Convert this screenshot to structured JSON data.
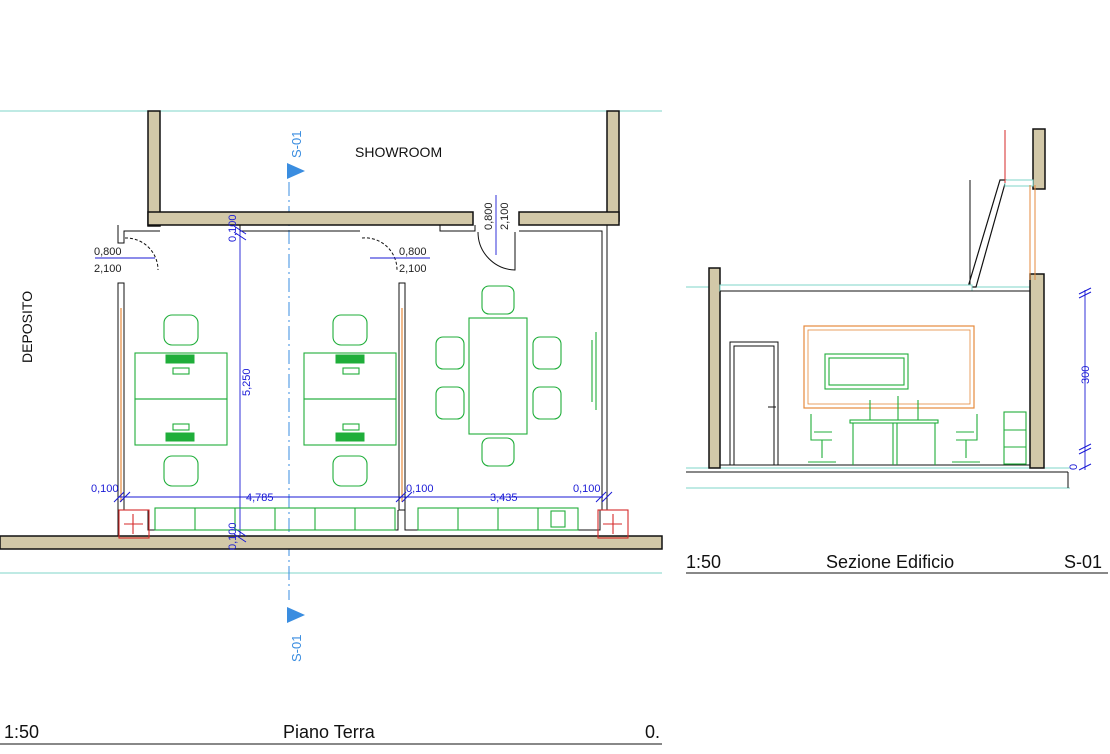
{
  "plan": {
    "showroom_label": "SHOWROOM",
    "deposito_label": "DEPOSITO",
    "section_tag_top": "S-01",
    "section_tag_bottom": "S-01",
    "door_left": {
      "width": "0,800",
      "height": "2,100"
    },
    "door_middle": {
      "width": "0,800",
      "height": "2,100"
    },
    "door_top": {
      "width": "0,800",
      "height": "2,100"
    },
    "dim_top_wall": "0,100",
    "dim_bottom_wall": "0,100",
    "dim_height": "5,250",
    "dim_left_wall": "0,100",
    "dim_room1": "4,785",
    "dim_mid_wall": "0,100",
    "dim_room2": "3,435",
    "dim_right_wall": "0,100"
  },
  "section": {
    "dim_height": "300",
    "dim_base": "0"
  },
  "title_plan": {
    "scale": "1:50",
    "name": "Piano Terra",
    "id": "0."
  },
  "title_section": {
    "scale": "1:50",
    "name": "Sezione Edificio",
    "id": "S-01"
  },
  "colors": {
    "wall": "#d2c8a8",
    "furniture": "#1fae3a",
    "dimension": "#1a1ad6",
    "grid": "#7fd6c8",
    "section_marker": "#3a8de0"
  }
}
